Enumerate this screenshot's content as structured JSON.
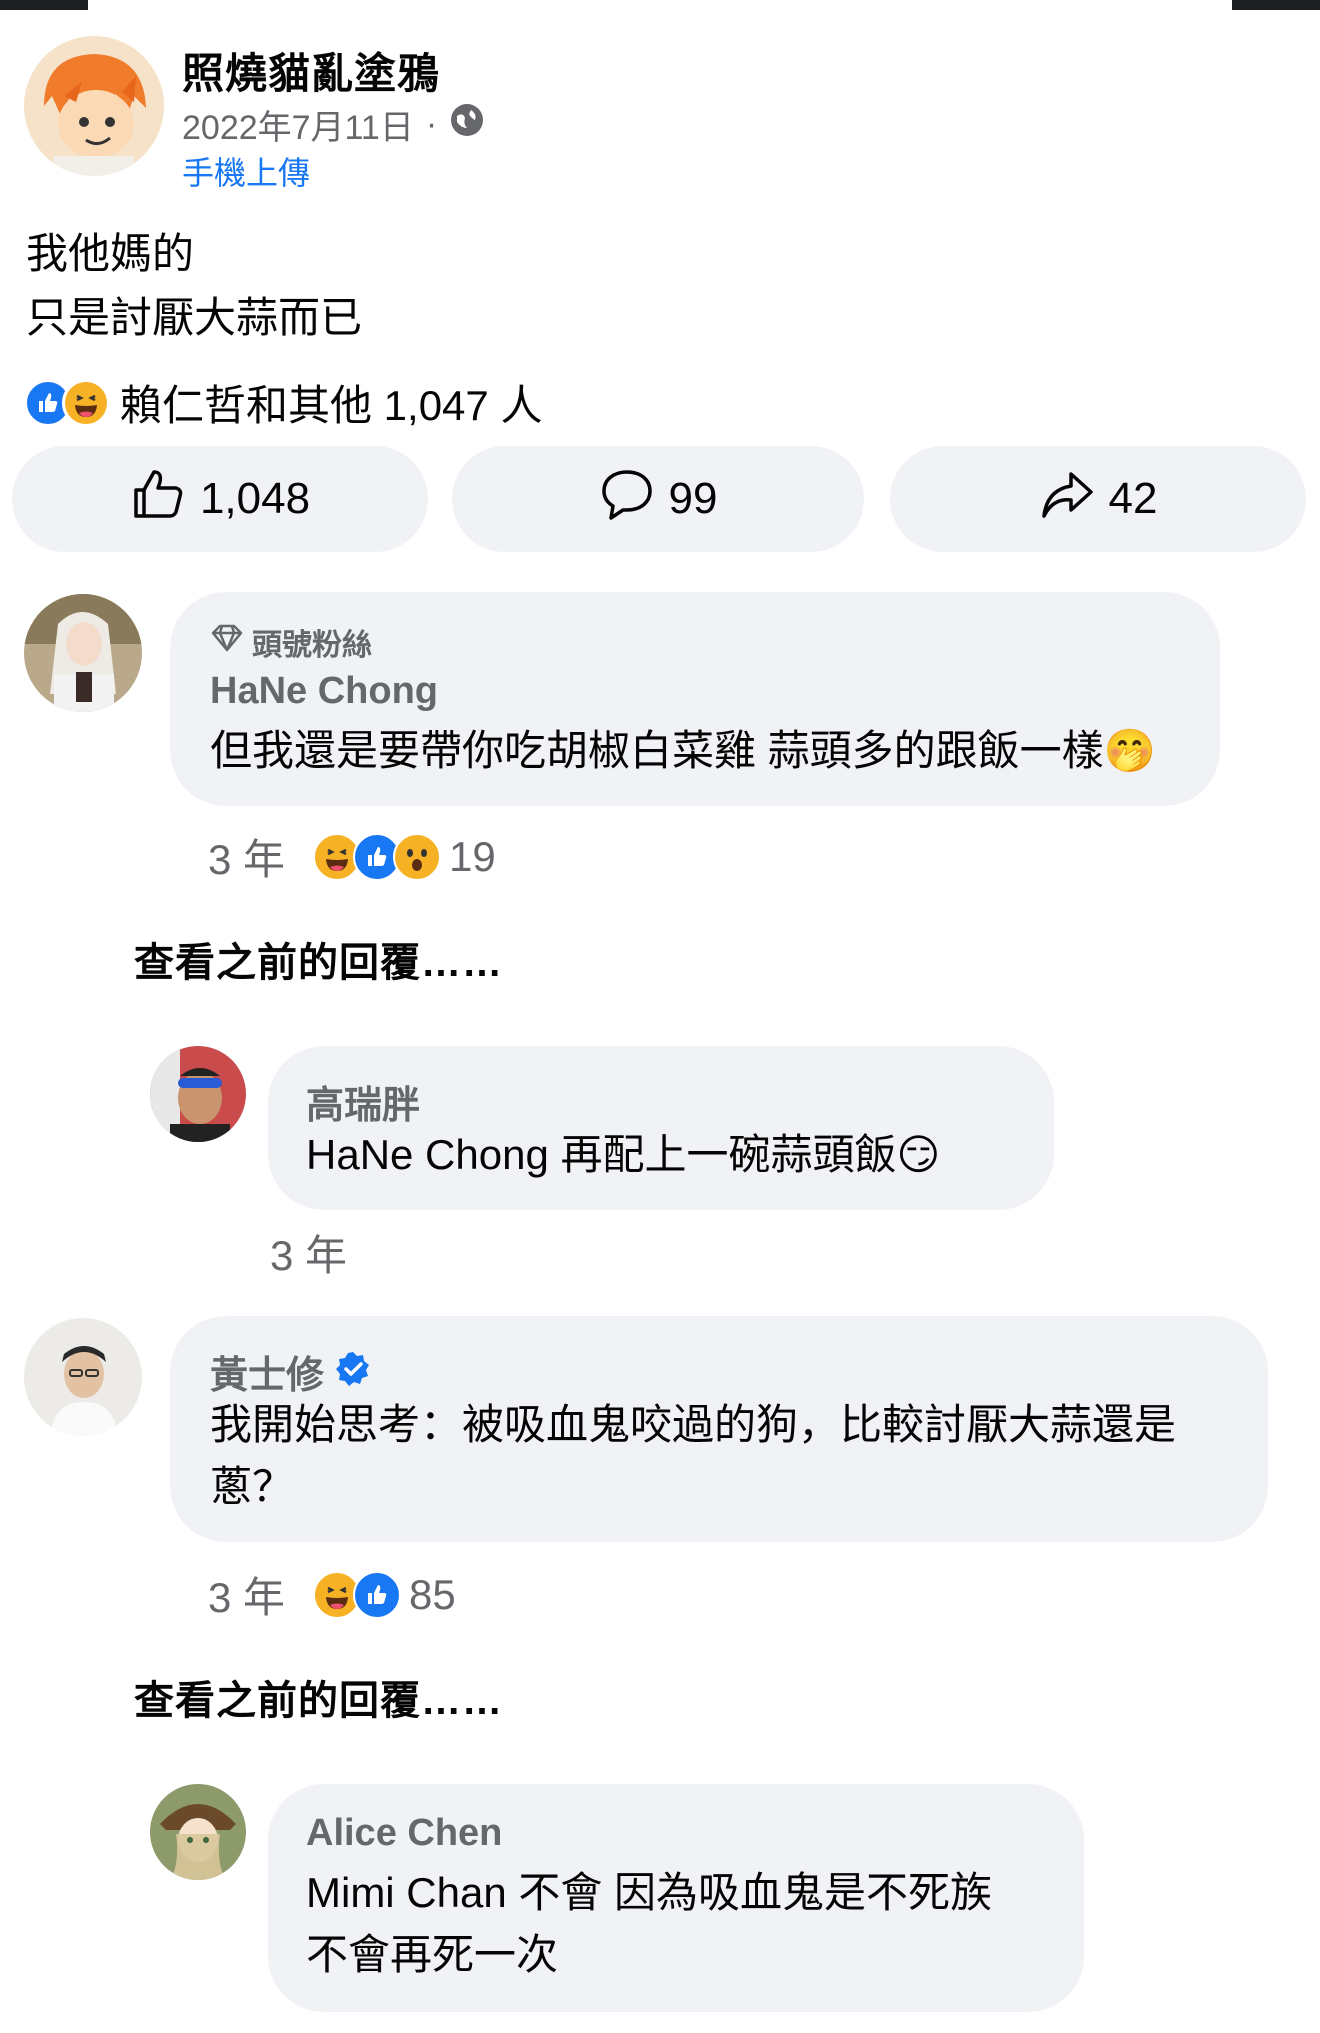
{
  "post": {
    "author": "照燒貓亂塗鴉",
    "date": "2022年7月11日",
    "separator": "·",
    "privacy_icon": "globe-icon",
    "upload_via": "手機上傳",
    "text_line1": "我他媽的",
    "text_line2": "只是討厭大蒜而已",
    "reaction_summary": "賴仁哲和其他 1,047 人",
    "reaction_icons": [
      "like",
      "haha"
    ],
    "actions": {
      "like_count": "1,048",
      "comment_count": "99",
      "share_count": "42"
    }
  },
  "comments": [
    {
      "badge": "頭號粉絲",
      "name": "HaNe Chong",
      "text": "但我還是要帶你吃胡椒白菜雞 蒜頭多的跟飯一樣🤭",
      "time": "3 年",
      "reaction_icons": [
        "haha",
        "like",
        "wow"
      ],
      "reaction_count": "19",
      "view_previous": "查看之前的回覆……",
      "reply": {
        "name": "高瑞胖",
        "text": "HaNe Chong 再配上一碗蒜頭飯😏",
        "time": "3 年"
      }
    },
    {
      "name": "黃士修",
      "verified": true,
      "text_line1": "我開始思考：被吸血鬼咬過的狗，比較討厭大蒜還是",
      "text_line2": "蔥？",
      "time": "3 年",
      "reaction_icons": [
        "haha",
        "like"
      ],
      "reaction_count": "85",
      "view_previous": "查看之前的回覆……",
      "reply": {
        "name": "Alice Chen",
        "text_line1": "Mimi Chan 不會 因為吸血鬼是不死族",
        "text_line2": "不會再死一次"
      }
    }
  ],
  "colors": {
    "bubble": "#f0f2f5",
    "secondary_text": "#65676b",
    "link_blue": "#1877f2",
    "like_blue": "#1877f2",
    "haha_yellow": "#f7b125"
  }
}
